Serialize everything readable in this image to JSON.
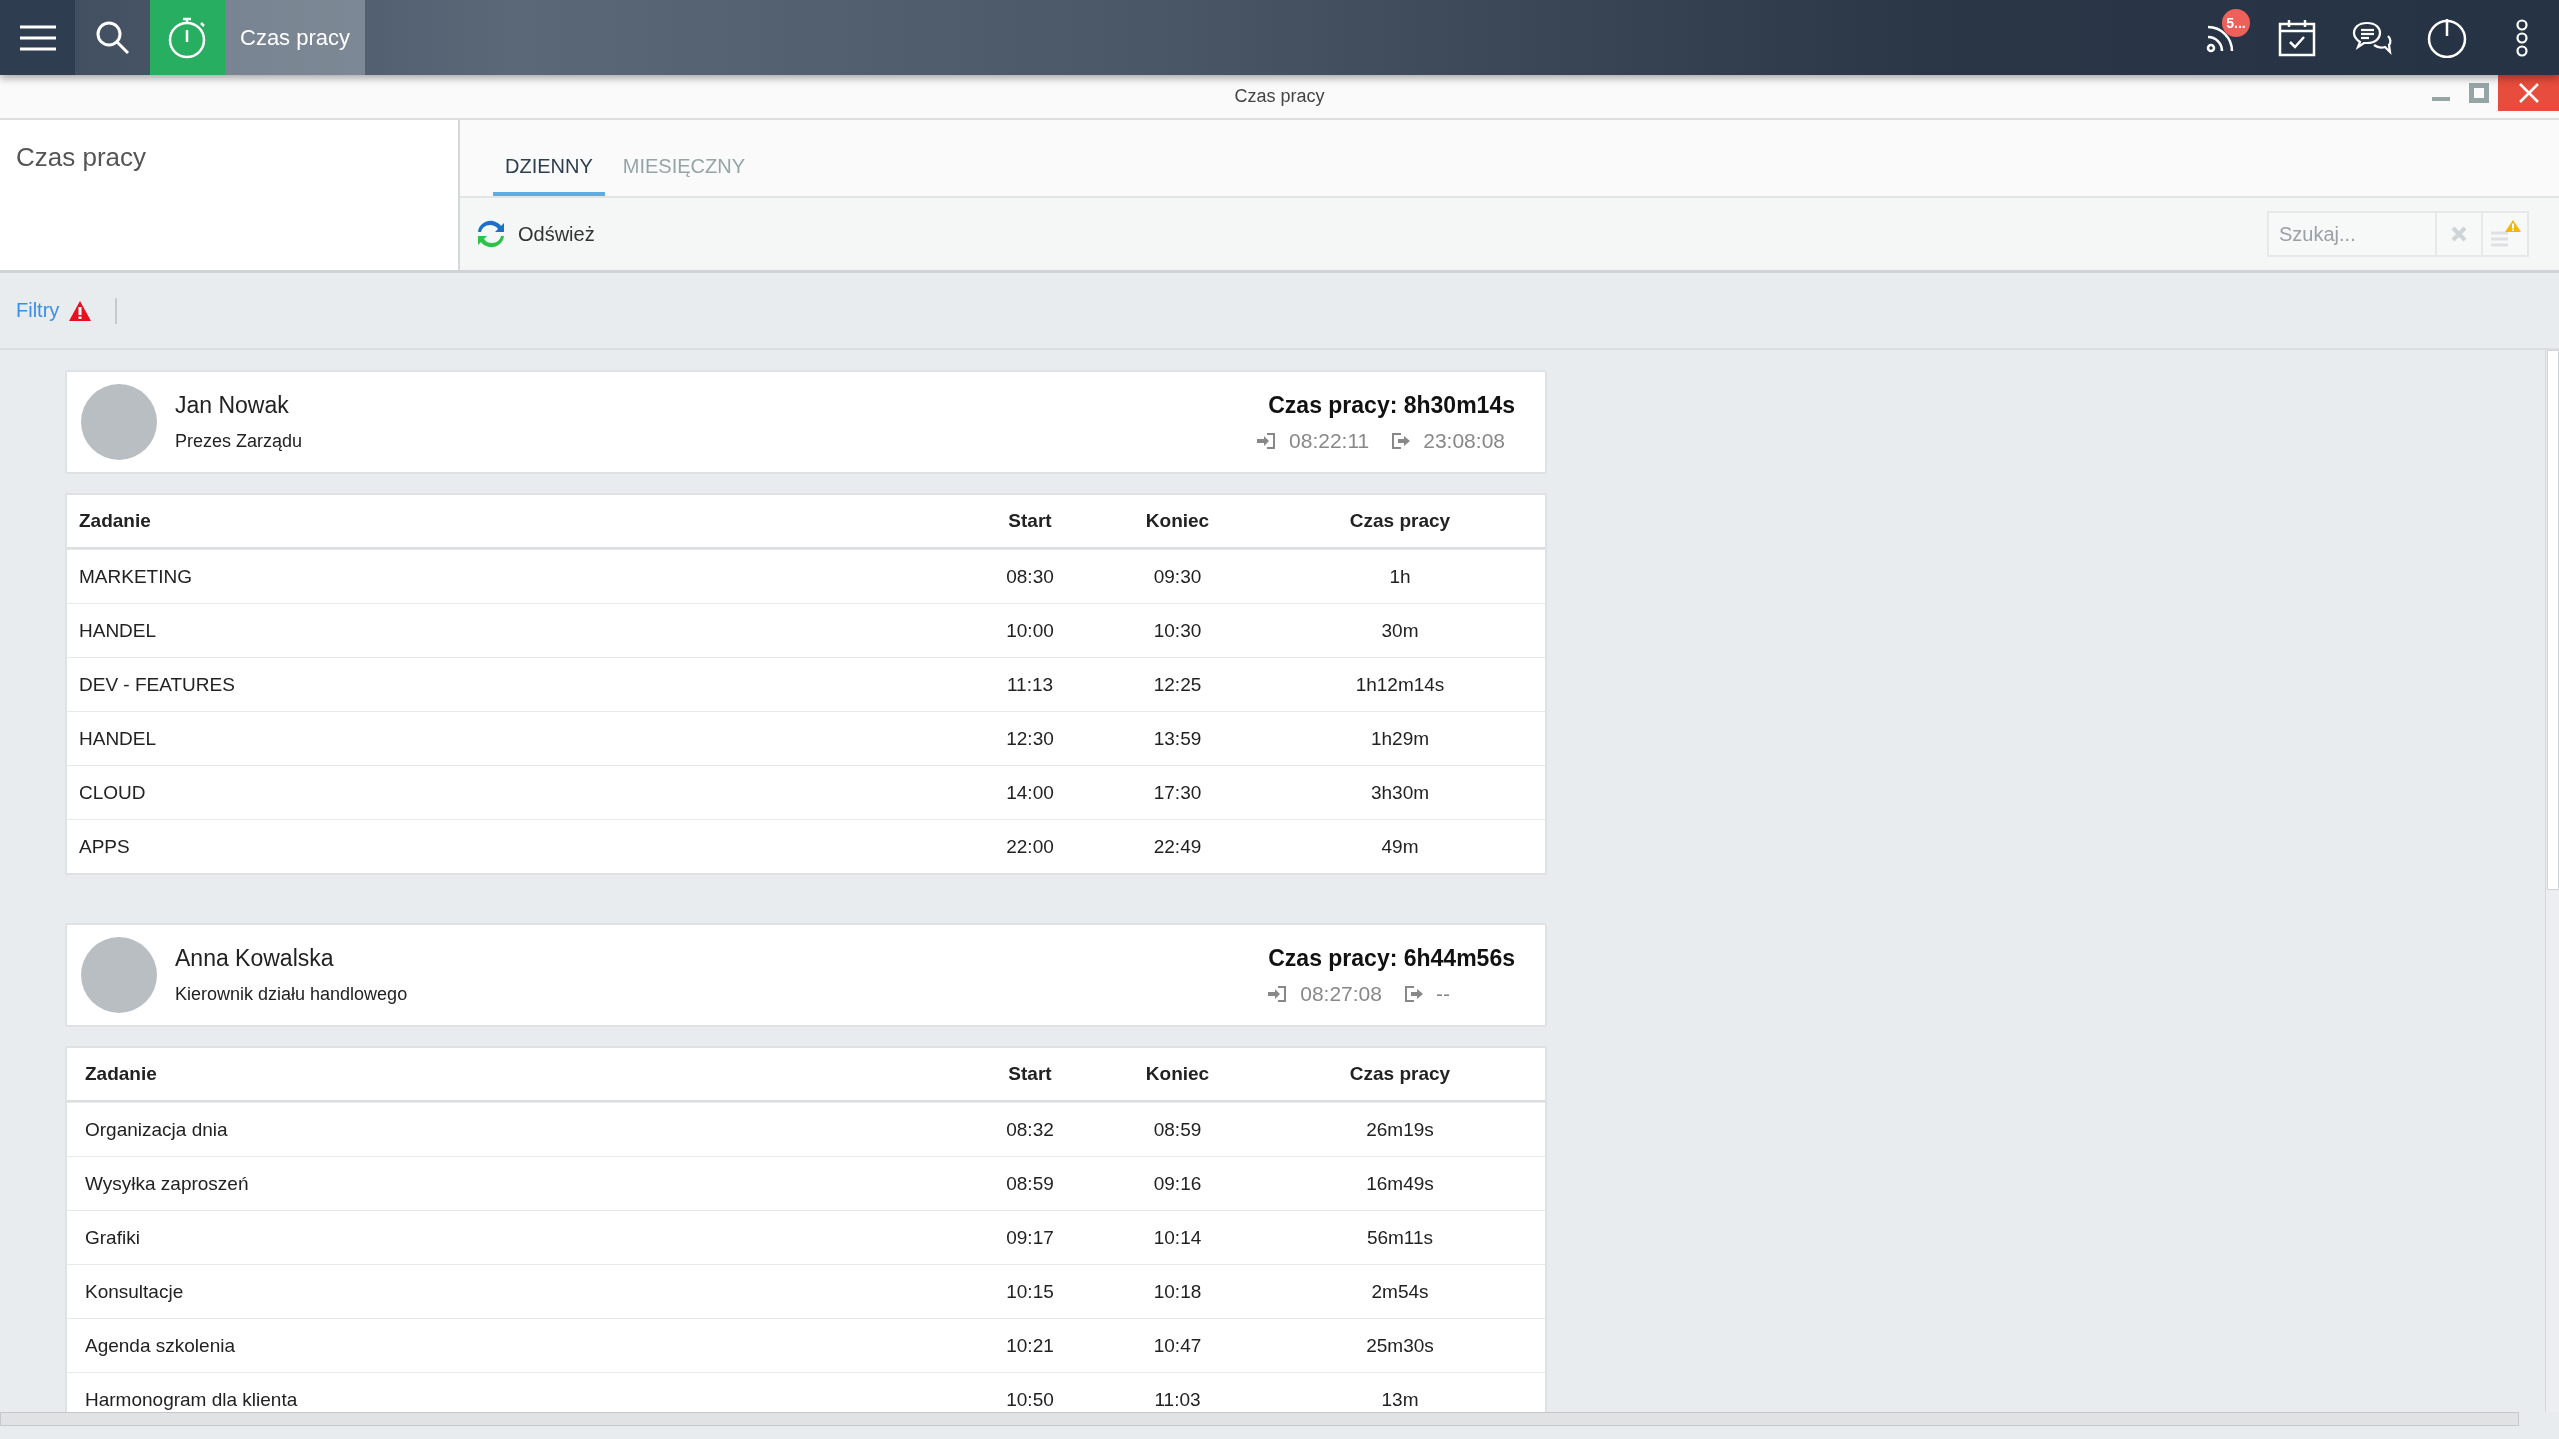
{
  "topbar": {
    "app_title": "Czas pracy",
    "notification_badge": "5..."
  },
  "window": {
    "title": "Czas pracy"
  },
  "module_title": "Czas pracy",
  "tabs": [
    {
      "label": "DZIENNY",
      "selected": true
    },
    {
      "label": "MIESIĘCZNY",
      "selected": false
    }
  ],
  "toolbar": {
    "refresh_label": "Odśwież",
    "search": {
      "placeholder": "Szukaj..."
    }
  },
  "filters": {
    "label": "Filtry"
  },
  "employees": [
    {
      "name": "Jan Nowak",
      "position": "Prezes Zarządu",
      "total": "Czas pracy: 8h30m14s",
      "clock_in": "08:22:11",
      "clock_out": "23:08:08",
      "table": {
        "columns": [
          "Zadanie",
          "Start",
          "Koniec",
          "Czas pracy"
        ],
        "rows": [
          [
            "MARKETING",
            "08:30",
            "09:30",
            "1h"
          ],
          [
            "HANDEL",
            "10:00",
            "10:30",
            "30m"
          ],
          [
            "DEV - FEATURES",
            "11:13",
            "12:25",
            "1h12m14s"
          ],
          [
            "HANDEL",
            "12:30",
            "13:59",
            "1h29m"
          ],
          [
            "CLOUD",
            "14:00",
            "17:30",
            "3h30m"
          ],
          [
            "APPS",
            "22:00",
            "22:49",
            "49m"
          ]
        ]
      }
    },
    {
      "name": "Anna Kowalska",
      "position": "Kierownik działu handlowego",
      "total": "Czas pracy: 6h44m56s",
      "clock_in": "08:27:08",
      "clock_out": "--",
      "table": {
        "columns": [
          "Zadanie",
          "Start",
          "Koniec",
          "Czas pracy"
        ],
        "rows": [
          [
            "Organizacja dnia",
            "08:32",
            "08:59",
            "26m19s"
          ],
          [
            "Wysyłka zaproszeń",
            "08:59",
            "09:16",
            "16m49s"
          ],
          [
            "Grafiki",
            "09:17",
            "10:14",
            "56m11s"
          ],
          [
            "Konsultacje",
            "10:15",
            "10:18",
            "2m54s"
          ],
          [
            "Agenda szkolenia",
            "10:21",
            "10:47",
            "25m30s"
          ],
          [
            "Harmonogram dla klienta",
            "10:50",
            "11:03",
            "13m"
          ]
        ]
      }
    }
  ]
}
